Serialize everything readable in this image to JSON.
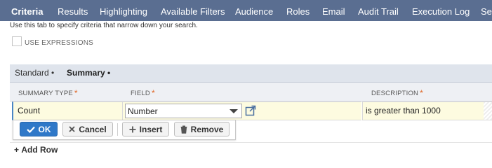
{
  "top_tabs": {
    "criteria": "Criteria",
    "results": "Results",
    "highlighting": "Highlighting",
    "available_filters": "Available Filters",
    "audience": "Audience",
    "roles": "Roles",
    "email": "Email",
    "audit_trail": "Audit Trail",
    "execution_log": "Execution Log",
    "more": "Sea"
  },
  "help_text": "Use this tab to specify criteria that narrow down your search.",
  "use_expressions_label": "USE EXPRESSIONS",
  "subtabs": {
    "standard": "Standard",
    "summary": "Summary",
    "dot": "•"
  },
  "grid": {
    "headers": {
      "summary_type": "SUMMARY TYPE",
      "field": "FIELD",
      "description": "DESCRIPTION",
      "required_mark": "*"
    },
    "row": {
      "summary_type": "Count",
      "field": "Number",
      "description": "is greater than 1000"
    }
  },
  "actions": {
    "ok": "OK",
    "cancel": "Cancel",
    "insert": "Insert",
    "remove": "Remove"
  },
  "add_row": "Add Row",
  "colors": {
    "topbar": "#5a6e91",
    "primary_button": "#2f78c8",
    "required": "#e06a2b",
    "edit_cell": "#fdfbe0"
  }
}
